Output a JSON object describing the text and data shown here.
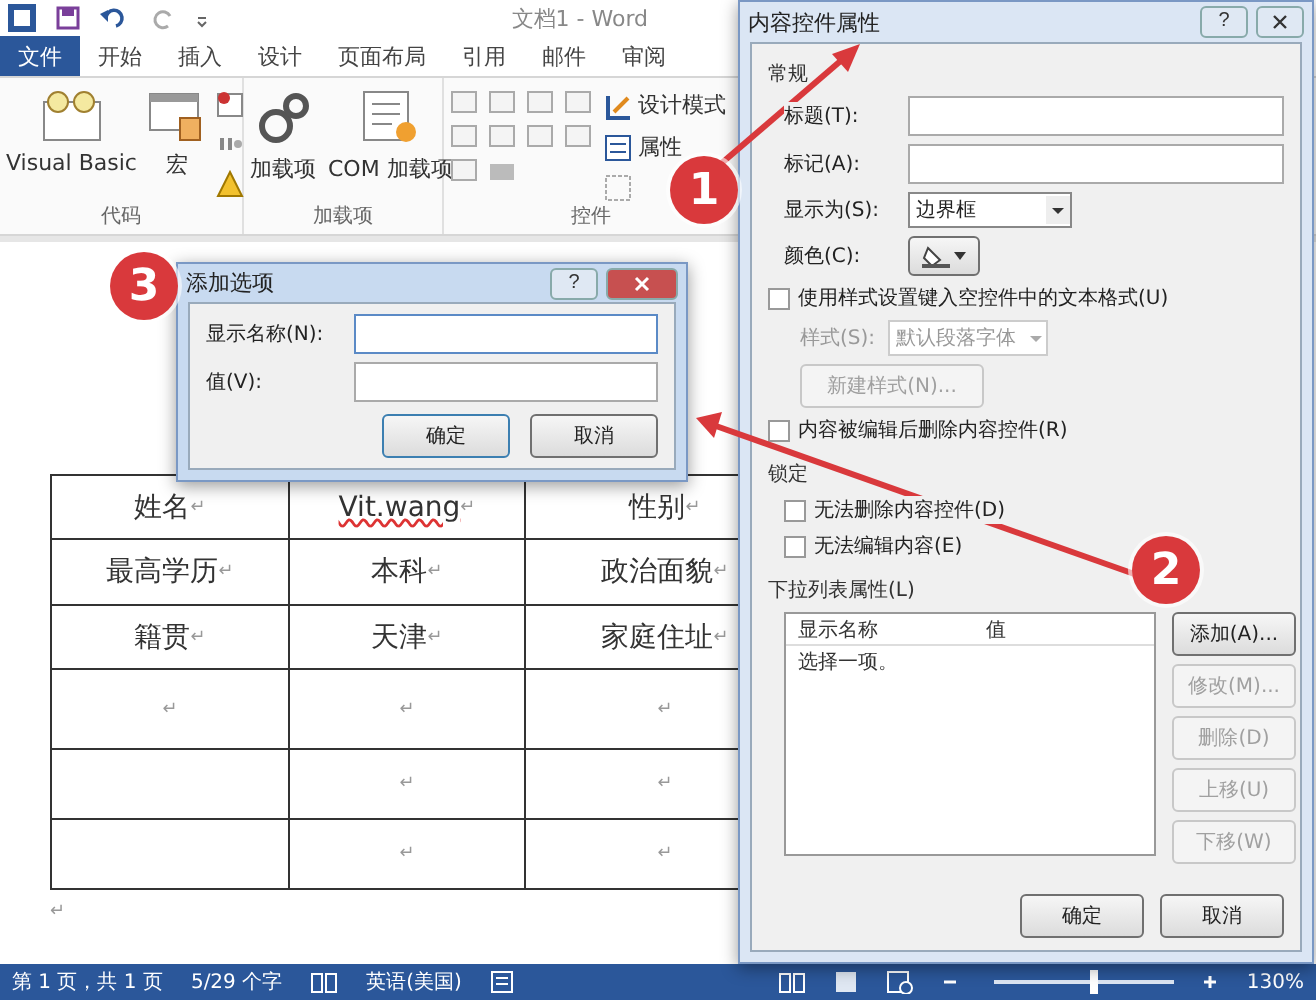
{
  "window": {
    "title": "文档1 - Word"
  },
  "tabs": [
    {
      "label": "文件",
      "kind": "file"
    },
    {
      "label": "开始",
      "kind": "tab"
    },
    {
      "label": "插入",
      "kind": "tab"
    },
    {
      "label": "设计",
      "kind": "tab"
    },
    {
      "label": "页面布局",
      "kind": "tab"
    },
    {
      "label": "引用",
      "kind": "tab"
    },
    {
      "label": "邮件",
      "kind": "tab"
    },
    {
      "label": "审阅",
      "kind": "tab"
    }
  ],
  "ribbon_groups": [
    {
      "label": "代码",
      "kind": "code",
      "buttons": [
        "Visual Basic",
        "宏"
      ]
    },
    {
      "label": "加载项",
      "kind": "addins",
      "buttons": [
        "加载项",
        "COM 加载项"
      ]
    },
    {
      "label": "控件",
      "kind": "controls",
      "buttons": [
        "设计模式",
        "属性"
      ]
    }
  ],
  "table": {
    "rows": [
      [
        {
          "text": "姓名",
          "mark": "↵"
        },
        {
          "text": "Vit.wang",
          "mark": "↵",
          "spelling_error": true
        },
        {
          "text": "性别",
          "mark": "↵"
        }
      ],
      [
        {
          "text": "最高学历",
          "mark": "↵"
        },
        {
          "text": "本科",
          "mark": "↵"
        },
        {
          "text": "政治面貌",
          "mark": "↵"
        }
      ],
      [
        {
          "text": "籍贯",
          "mark": "↵"
        },
        {
          "text": "天津",
          "mark": "↵"
        },
        {
          "text": "家庭住址",
          "mark": "↵"
        }
      ],
      [
        {
          "mark": "↵"
        },
        {
          "mark": "↵"
        },
        {
          "mark": "↵"
        }
      ],
      [
        {},
        {
          "mark": "↵"
        },
        {
          "mark": "↵"
        }
      ],
      [
        {},
        {
          "mark": "↵"
        },
        {
          "mark": "↵"
        }
      ]
    ],
    "end_mark": "↵"
  },
  "status_bar": {
    "page": "第 1 页，共 1 页",
    "words": "5/29 个字",
    "language": "英语(美国)",
    "zoom": {
      "level": 0.55,
      "reading": "130%"
    }
  },
  "add_dialog": {
    "title": "添加选项",
    "help": "?",
    "fields": [
      {
        "label": "显示名称(N):",
        "focused": true
      },
      {
        "label": "值(V):",
        "focused": false
      }
    ],
    "buttons": [
      {
        "label": "确定",
        "default": true
      },
      {
        "label": "取消",
        "default": false
      }
    ]
  },
  "properties_dialog": {
    "title": "内容控件属性",
    "help": "?",
    "general": {
      "heading": "常规",
      "fields": [
        {
          "label": "标题(T):"
        },
        {
          "label": "标记(A):"
        }
      ],
      "show_as": {
        "label": "显示为(S):",
        "value": "边界框"
      },
      "color": {
        "label": "颜色(C):"
      },
      "use_style": {
        "label": "使用样式设置键入空控件中的文本格式(U)",
        "checked": false
      },
      "style": {
        "label": "样式(S):",
        "value": "默认段落字体",
        "disabled": true
      },
      "new_style": {
        "label": "新建样式(N)...",
        "disabled": true
      },
      "remove": {
        "label": "内容被编辑后删除内容控件(R)",
        "checked": false
      }
    },
    "locking": {
      "heading": "锁定",
      "options": [
        {
          "label": "无法删除内容控件(D)",
          "checked": false
        },
        {
          "label": "无法编辑内容(E)",
          "checked": false
        }
      ]
    },
    "list": {
      "heading": "下拉列表属性(L)",
      "columns": [
        "显示名称",
        "值"
      ],
      "rows": [
        {
          "name": "选择一项。",
          "selected": false
        }
      ],
      "buttons": [
        {
          "label": "添加(A)...",
          "disabled": false
        },
        {
          "label": "修改(M)...",
          "disabled": true
        },
        {
          "label": "删除(D)",
          "disabled": true
        },
        {
          "label": "上移(U)",
          "disabled": true
        },
        {
          "label": "下移(W)",
          "disabled": true
        }
      ]
    },
    "buttons": [
      "确定",
      "取消"
    ]
  },
  "callouts": [
    {
      "number": "1"
    },
    {
      "number": "2"
    },
    {
      "number": "3"
    }
  ]
}
